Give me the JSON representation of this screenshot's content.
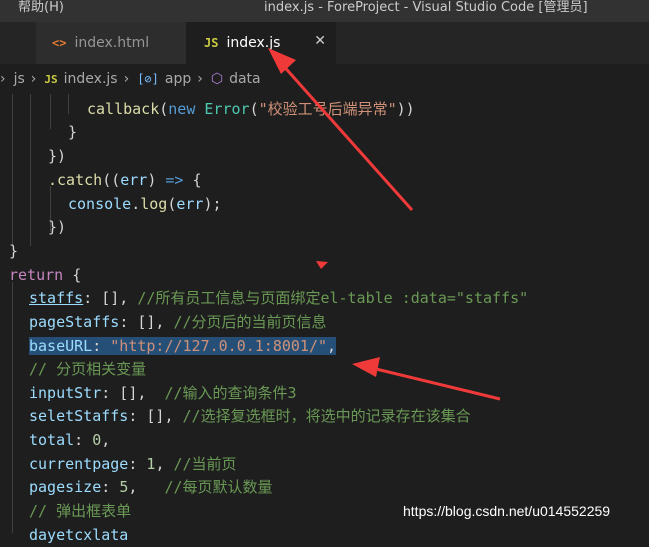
{
  "titlebar": {
    "menu_help": "帮助(H)",
    "window_title": "index.js - ForeProject - Visual Studio Code [管理员]"
  },
  "tabs": [
    {
      "label": "index.html",
      "icon": "html-file-icon"
    },
    {
      "label": "index.js",
      "icon": "js-file-icon",
      "active": true,
      "close_glyph": "✕"
    }
  ],
  "breadcrumb": {
    "folder": "js",
    "file": "index.js",
    "object": "app",
    "property": "data"
  },
  "code": {
    "line_callback": [
      "callback",
      "(",
      "new",
      " ",
      "Error",
      "(",
      "\"校验工号后端异常\"",
      "))"
    ],
    "brace1": "}",
    "close1": "})",
    "catch_line": [
      ".catch",
      "((",
      "err",
      ") ",
      "=>",
      " {"
    ],
    "console_line": [
      "console",
      ".",
      "log",
      "(",
      "err",
      ");"
    ],
    "close2": "})",
    "brace2": "}",
    "return_line": [
      "return",
      " {"
    ],
    "staffs": [
      "staffs",
      ": [], ",
      "//所有员工信息与页面绑定el-table :data=\"staffs\""
    ],
    "pageStaffs": [
      "pageStaffs",
      ": [], ",
      "//分页后的当前页信息"
    ],
    "baseURL": [
      "baseURL",
      ": ",
      "\"http://127.0.0.1:8001/\"",
      ","
    ],
    "comment_paging": "// 分页相关变量",
    "inputStr": [
      "inputStr",
      ": [],  ",
      "//输入的查询条件3"
    ],
    "seletStaffs": [
      "seletStaffs",
      ": [], ",
      "//选择复选框时，将选中的记录存在该集合"
    ],
    "total": [
      "total",
      ": ",
      "0",
      ","
    ],
    "currentpage": [
      "currentpage",
      ": ",
      "1",
      ", ",
      "//当前页"
    ],
    "pagesize": [
      "pagesize",
      ": ",
      "5",
      ",   ",
      "//每页默认数量"
    ],
    "comment_dialog": "// 弹出框表单",
    "partial_last": "dayetcxlata"
  },
  "watermark": "https://blog.csdn.net/u014552259",
  "colors": {
    "annotation_red": "#f03a3a",
    "selection": "#264f78",
    "keyword": "#569cd6",
    "string": "#ce9178",
    "comment": "#6a9955"
  }
}
